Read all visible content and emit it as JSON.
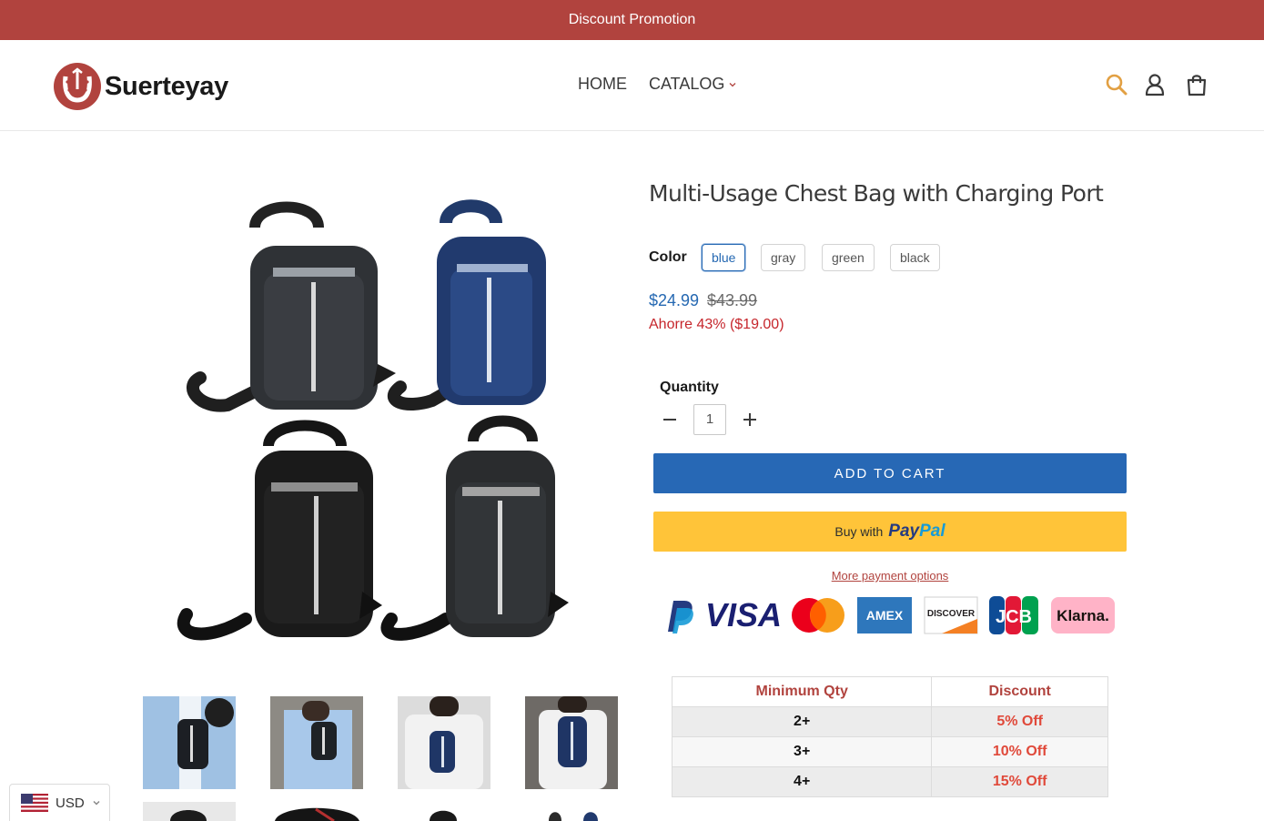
{
  "announcement": "Discount Promotion",
  "brand": {
    "name": "Suerteyay",
    "accent": "#b1433e"
  },
  "nav": [
    {
      "label": "HOME"
    },
    {
      "label": "CATALOG"
    }
  ],
  "header_icons": [
    "search-icon",
    "account-icon",
    "cart-icon"
  ],
  "product": {
    "title": "Multi-Usage Chest Bag with Charging Port",
    "color_label": "Color",
    "colors": [
      "blue",
      "gray",
      "green",
      "black"
    ],
    "selected_color": "blue",
    "price": "$24.99",
    "compare_price": "$43.99",
    "savings": "Ahorre 43% ($19.00)",
    "quantity_label": "Quantity",
    "quantity": "1",
    "add_to_cart": "ADD TO CART",
    "paypal": {
      "prefix": "Buy with",
      "pay": "Pay",
      "pal": "Pal"
    },
    "more_payment": "More payment options"
  },
  "payment_logos": [
    "PayPal",
    "VISA",
    "Mastercard",
    "AMEX",
    "DISCOVER",
    "JCB",
    "Klarna."
  ],
  "discount_table": {
    "headers": [
      "Minimum Qty",
      "Discount"
    ],
    "rows": [
      {
        "qty": "2+",
        "discount": "5% Off"
      },
      {
        "qty": "3+",
        "discount": "10% Off"
      },
      {
        "qty": "4+",
        "discount": "15% Off"
      }
    ]
  },
  "currency": {
    "code": "USD"
  },
  "colors": {
    "primary_button": "#2768b5",
    "paypal_yellow": "#ffc439",
    "price_blue": "#2568b2",
    "sale_red": "#c6262c"
  }
}
